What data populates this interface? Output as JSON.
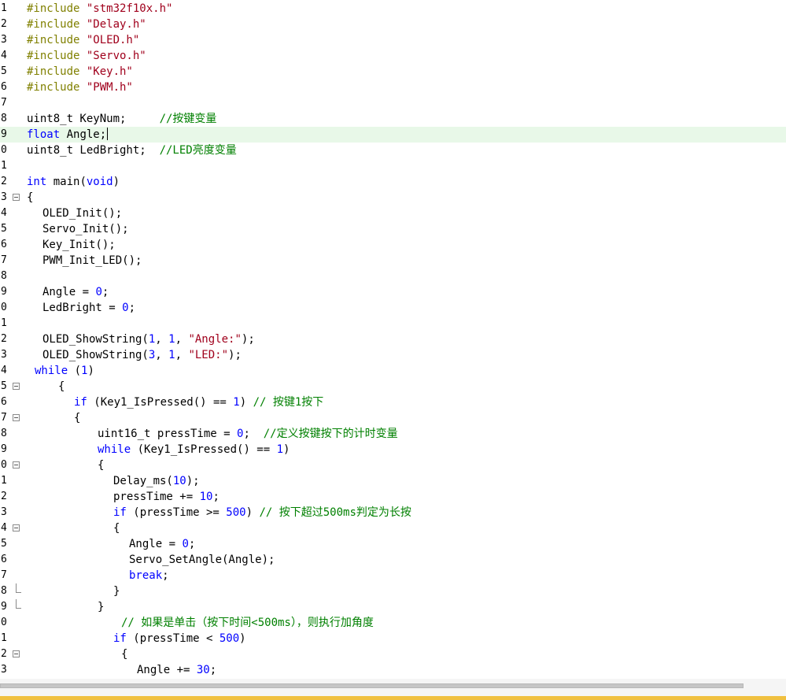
{
  "editor": {
    "colors": {
      "preprocessor": "#808000",
      "string": "#a0001c",
      "keyword": "#0000ff",
      "number": "#0000ff",
      "comment": "#008000",
      "text": "#000000",
      "current_line_bg": "#e8f8e8"
    },
    "current_line": 9,
    "lines": [
      {
        "num": "1",
        "fold": "",
        "indent": 0,
        "tokens": [
          [
            "pre",
            "#include "
          ],
          [
            "str",
            "\"stm32f10x.h\""
          ]
        ]
      },
      {
        "num": "2",
        "fold": "",
        "indent": 0,
        "tokens": [
          [
            "pre",
            "#include "
          ],
          [
            "str",
            "\"Delay.h\""
          ]
        ]
      },
      {
        "num": "3",
        "fold": "",
        "indent": 0,
        "tokens": [
          [
            "pre",
            "#include "
          ],
          [
            "str",
            "\"OLED.h\""
          ]
        ]
      },
      {
        "num": "4",
        "fold": "",
        "indent": 0,
        "tokens": [
          [
            "pre",
            "#include "
          ],
          [
            "str",
            "\"Servo.h\""
          ]
        ]
      },
      {
        "num": "5",
        "fold": "",
        "indent": 0,
        "tokens": [
          [
            "pre",
            "#include "
          ],
          [
            "str",
            "\"Key.h\""
          ]
        ]
      },
      {
        "num": "6",
        "fold": "",
        "indent": 0,
        "tokens": [
          [
            "pre",
            "#include "
          ],
          [
            "str",
            "\"PWM.h\""
          ]
        ]
      },
      {
        "num": "7",
        "fold": "",
        "indent": 0,
        "tokens": []
      },
      {
        "num": "8",
        "fold": "",
        "indent": 0,
        "tokens": [
          [
            "txt",
            "uint8_t KeyNum;     "
          ],
          [
            "cmt",
            "//按键变量"
          ]
        ]
      },
      {
        "num": "9",
        "fold": "",
        "indent": 0,
        "tokens": [
          [
            "kw",
            "float"
          ],
          [
            "txt",
            " Angle;"
          ]
        ],
        "caret": true
      },
      {
        "num": "0",
        "fold": "",
        "indent": 0,
        "tokens": [
          [
            "txt",
            "uint8_t LedBright;  "
          ],
          [
            "cmt",
            "//LED亮度变量"
          ]
        ]
      },
      {
        "num": "1",
        "fold": "",
        "indent": 0,
        "tokens": []
      },
      {
        "num": "2",
        "fold": "",
        "indent": 0,
        "tokens": [
          [
            "kw",
            "int"
          ],
          [
            "txt",
            " main("
          ],
          [
            "kw",
            "void"
          ],
          [
            "txt",
            ")"
          ]
        ]
      },
      {
        "num": "3",
        "fold": "open",
        "indent": 0,
        "tokens": [
          [
            "txt",
            "{"
          ]
        ]
      },
      {
        "num": "4",
        "fold": "",
        "indent": 20,
        "tokens": [
          [
            "txt",
            "OLED_Init();"
          ]
        ]
      },
      {
        "num": "5",
        "fold": "",
        "indent": 20,
        "tokens": [
          [
            "txt",
            "Servo_Init();"
          ]
        ]
      },
      {
        "num": "6",
        "fold": "",
        "indent": 20,
        "tokens": [
          [
            "txt",
            "Key_Init();"
          ]
        ]
      },
      {
        "num": "7",
        "fold": "",
        "indent": 20,
        "tokens": [
          [
            "txt",
            "PWM_Init_LED();"
          ]
        ]
      },
      {
        "num": "8",
        "fold": "",
        "indent": 0,
        "tokens": []
      },
      {
        "num": "9",
        "fold": "",
        "indent": 20,
        "tokens": [
          [
            "txt",
            "Angle = "
          ],
          [
            "num",
            "0"
          ],
          [
            "txt",
            ";"
          ]
        ]
      },
      {
        "num": "0",
        "fold": "",
        "indent": 20,
        "tokens": [
          [
            "txt",
            "LedBright = "
          ],
          [
            "num",
            "0"
          ],
          [
            "txt",
            ";"
          ]
        ]
      },
      {
        "num": "1",
        "fold": "",
        "indent": 0,
        "tokens": []
      },
      {
        "num": "2",
        "fold": "",
        "indent": 20,
        "tokens": [
          [
            "txt",
            "OLED_ShowString("
          ],
          [
            "num",
            "1"
          ],
          [
            "txt",
            ", "
          ],
          [
            "num",
            "1"
          ],
          [
            "txt",
            ", "
          ],
          [
            "str",
            "\"Angle:\""
          ],
          [
            "txt",
            ");"
          ]
        ]
      },
      {
        "num": "3",
        "fold": "",
        "indent": 20,
        "tokens": [
          [
            "txt",
            "OLED_ShowString("
          ],
          [
            "num",
            "3"
          ],
          [
            "txt",
            ", "
          ],
          [
            "num",
            "1"
          ],
          [
            "txt",
            ", "
          ],
          [
            "str",
            "\"LED:\""
          ],
          [
            "txt",
            ");"
          ]
        ]
      },
      {
        "num": "4",
        "fold": "",
        "indent": 10,
        "tokens": [
          [
            "kw",
            "while"
          ],
          [
            "txt",
            " ("
          ],
          [
            "num",
            "1"
          ],
          [
            "txt",
            ")"
          ]
        ]
      },
      {
        "num": "5",
        "fold": "open",
        "indent": 40,
        "tokens": [
          [
            "txt",
            "{"
          ]
        ]
      },
      {
        "num": "6",
        "fold": "",
        "indent": 60,
        "tokens": [
          [
            "kw",
            "if"
          ],
          [
            "txt",
            " (Key1_IsPressed() == "
          ],
          [
            "num",
            "1"
          ],
          [
            "txt",
            ") "
          ],
          [
            "cmt",
            "// 按键1按下"
          ]
        ]
      },
      {
        "num": "7",
        "fold": "open",
        "indent": 60,
        "tokens": [
          [
            "txt",
            "{"
          ]
        ]
      },
      {
        "num": "8",
        "fold": "",
        "indent": 90,
        "tokens": [
          [
            "txt",
            "uint16_t pressTime = "
          ],
          [
            "num",
            "0"
          ],
          [
            "txt",
            ";  "
          ],
          [
            "cmt",
            "//定义按键按下的计时变量"
          ]
        ]
      },
      {
        "num": "9",
        "fold": "",
        "indent": 90,
        "tokens": [
          [
            "kw",
            "while"
          ],
          [
            "txt",
            " (Key1_IsPressed() == "
          ],
          [
            "num",
            "1"
          ],
          [
            "txt",
            ")"
          ]
        ]
      },
      {
        "num": "0",
        "fold": "open",
        "indent": 90,
        "tokens": [
          [
            "txt",
            "{"
          ]
        ]
      },
      {
        "num": "1",
        "fold": "",
        "indent": 110,
        "tokens": [
          [
            "txt",
            "Delay_ms("
          ],
          [
            "num",
            "10"
          ],
          [
            "txt",
            ");"
          ]
        ]
      },
      {
        "num": "2",
        "fold": "",
        "indent": 110,
        "tokens": [
          [
            "txt",
            "pressTime += "
          ],
          [
            "num",
            "10"
          ],
          [
            "txt",
            ";"
          ]
        ]
      },
      {
        "num": "3",
        "fold": "",
        "indent": 110,
        "tokens": [
          [
            "kw",
            "if"
          ],
          [
            "txt",
            " (pressTime >= "
          ],
          [
            "num",
            "500"
          ],
          [
            "txt",
            ") "
          ],
          [
            "cmt",
            "// 按下超过500ms判定为长按"
          ]
        ]
      },
      {
        "num": "4",
        "fold": "open",
        "indent": 110,
        "tokens": [
          [
            "txt",
            "{"
          ]
        ]
      },
      {
        "num": "5",
        "fold": "",
        "indent": 130,
        "tokens": [
          [
            "txt",
            "Angle = "
          ],
          [
            "num",
            "0"
          ],
          [
            "txt",
            ";"
          ]
        ]
      },
      {
        "num": "6",
        "fold": "",
        "indent": 130,
        "tokens": [
          [
            "txt",
            "Servo_SetAngle(Angle);"
          ]
        ]
      },
      {
        "num": "7",
        "fold": "",
        "indent": 130,
        "tokens": [
          [
            "kw",
            "break"
          ],
          [
            "txt",
            ";"
          ]
        ]
      },
      {
        "num": "8",
        "fold": "end",
        "indent": 110,
        "tokens": [
          [
            "txt",
            "}"
          ]
        ]
      },
      {
        "num": "9",
        "fold": "end",
        "indent": 90,
        "tokens": [
          [
            "txt",
            "}"
          ]
        ]
      },
      {
        "num": "0",
        "fold": "",
        "indent": 120,
        "tokens": [
          [
            "cmt",
            "// 如果是单击（按下时间<500ms），则执行加角度"
          ]
        ]
      },
      {
        "num": "1",
        "fold": "",
        "indent": 110,
        "tokens": [
          [
            "kw",
            "if"
          ],
          [
            "txt",
            " (pressTime < "
          ],
          [
            "num",
            "500"
          ],
          [
            "txt",
            ")"
          ]
        ]
      },
      {
        "num": "2",
        "fold": "open",
        "indent": 120,
        "tokens": [
          [
            "txt",
            "{"
          ]
        ]
      },
      {
        "num": "3",
        "fold": "",
        "indent": 140,
        "tokens": [
          [
            "txt",
            "Angle += "
          ],
          [
            "num",
            "30"
          ],
          [
            "txt",
            ";"
          ]
        ]
      }
    ]
  }
}
